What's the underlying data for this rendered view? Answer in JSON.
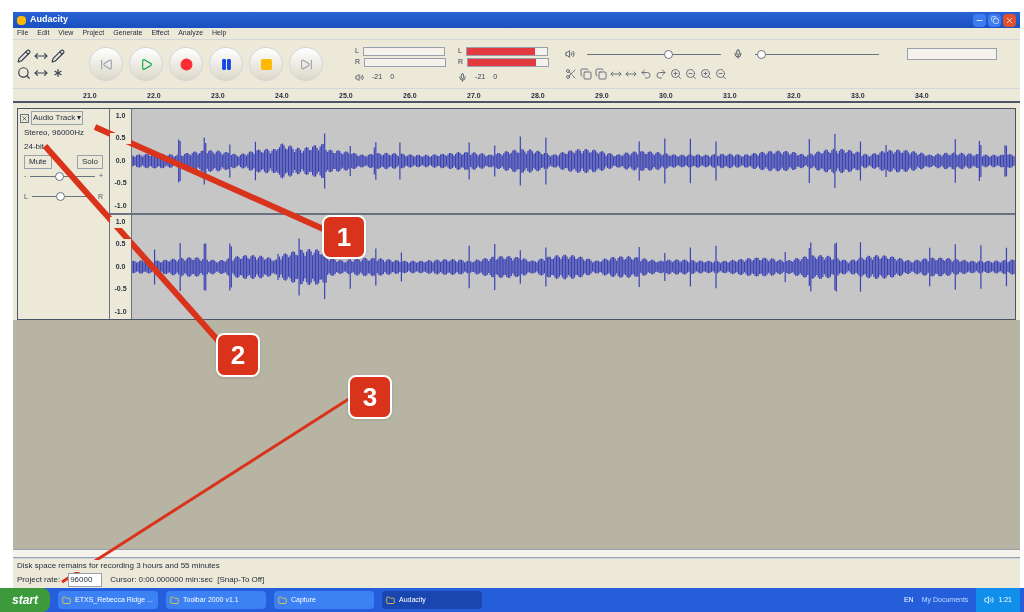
{
  "window": {
    "title": "Audacity"
  },
  "menu": [
    "File",
    "Edit",
    "View",
    "Project",
    "Generate",
    "Effect",
    "Analyze",
    "Help"
  ],
  "meters": {
    "play": {
      "channels": [
        "L",
        "R"
      ],
      "ticks": [
        "-21",
        "0"
      ]
    },
    "record": {
      "channels": [
        "L",
        "R"
      ],
      "level": 0.85,
      "ticks": [
        "-21",
        "0"
      ]
    }
  },
  "mixer": {
    "output": {
      "level": 0.6
    },
    "input": {
      "level": 0.05
    }
  },
  "ruler": [
    "21.0",
    "22.0",
    "23.0",
    "24.0",
    "25.0",
    "26.0",
    "27.0",
    "28.0",
    "29.0",
    "30.0",
    "31.0",
    "32.0",
    "33.0",
    "34.0"
  ],
  "track": {
    "name": "Audio Track",
    "menu_arrow": "▾",
    "format": "Stereo, 96000Hz",
    "bit_depth": "24-bit",
    "mute": "Mute",
    "solo": "Solo",
    "gain": {
      "min": "-",
      "max": "+",
      "level": 0.45
    },
    "pan": {
      "min": "L",
      "max": "R",
      "level": 0.45
    },
    "channels": [
      {
        "scale": [
          "1.0",
          "0.5",
          "0.0",
          "-0.5",
          "-1.0"
        ]
      },
      {
        "scale": [
          "1.0",
          "0.5",
          "0.0",
          "-0.5",
          "-1.0"
        ]
      }
    ]
  },
  "callouts": [
    {
      "label": "1"
    },
    {
      "label": "2"
    },
    {
      "label": "3"
    }
  ],
  "status": {
    "disk": "Disk space remains for recording 3 hours and 55 minutes",
    "rate_label": "Project rate:",
    "rate": "96000",
    "cursor": "Cursor: 0:00.000000 min:sec  [Snap-To Off]"
  },
  "taskbar": {
    "start": "start",
    "items": [
      {
        "label": "ETXS_Rebecca Ridge ...",
        "selected": false
      },
      {
        "label": "Toolbar 2000 v1.1",
        "selected": false
      },
      {
        "label": "Capture",
        "selected": false
      },
      {
        "label": "Audacity",
        "selected": true
      }
    ],
    "language": "EN",
    "documents": "My Documents",
    "clock": "1:21"
  }
}
